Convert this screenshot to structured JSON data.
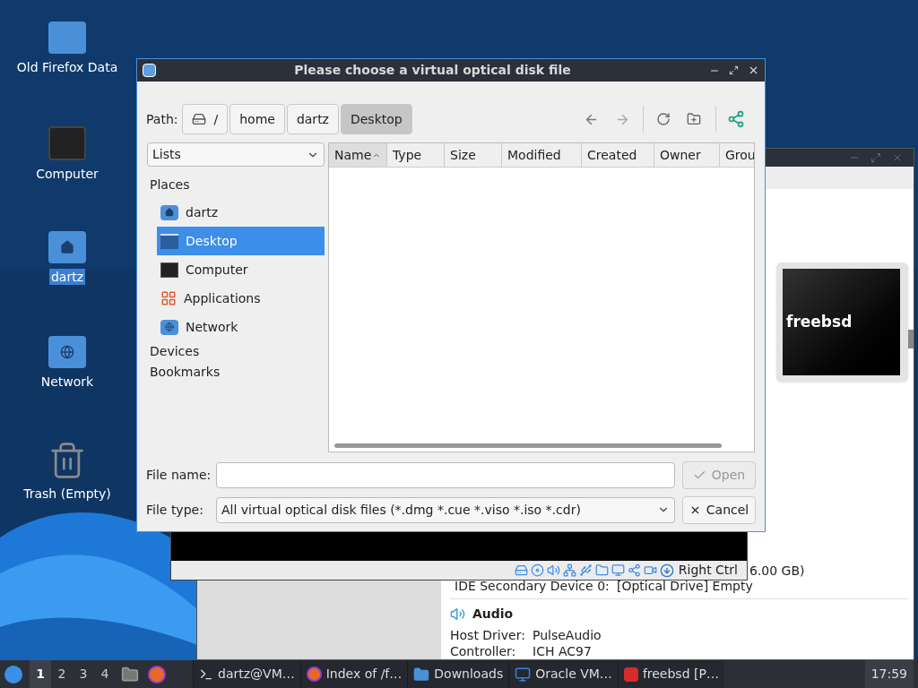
{
  "desktop_icons": [
    {
      "label": "Old Firefox Data",
      "kind": "folder",
      "selected": false
    },
    {
      "label": "Computer",
      "kind": "computer",
      "selected": false
    },
    {
      "label": "dartz",
      "kind": "home",
      "selected": true
    },
    {
      "label": "Network",
      "kind": "network",
      "selected": false
    },
    {
      "label": "Trash (Empty)",
      "kind": "trash",
      "selected": false
    }
  ],
  "manager_window": {
    "preview_title": "freebsd",
    "storage_fragment": "6.00 GB)",
    "storage_rows": [
      {
        "label": "IDE Secondary Device 0:",
        "value": "[Optical Drive] Empty"
      }
    ],
    "audio": {
      "title": "Audio",
      "rows": [
        {
          "label": "Host Driver:",
          "value": "PulseAudio"
        },
        {
          "label": "Controller:",
          "value": "ICH AC97"
        }
      ]
    }
  },
  "vm_window": {
    "host_key": "Right Ctrl"
  },
  "dialog": {
    "title": "Please choose a virtual optical disk file",
    "path_label": "Path:",
    "crumbs": [
      {
        "label": "/",
        "kind": "root",
        "selected": false
      },
      {
        "label": "home",
        "kind": "dir",
        "selected": false
      },
      {
        "label": "dartz",
        "kind": "dir",
        "selected": false
      },
      {
        "label": "Desktop",
        "kind": "dir",
        "selected": true
      }
    ],
    "view_select": "Lists",
    "places_heading": "Places",
    "places": [
      {
        "label": "dartz",
        "kind": "home",
        "selected": false
      },
      {
        "label": "Desktop",
        "kind": "desktop",
        "selected": true
      },
      {
        "label": "Computer",
        "kind": "computer",
        "selected": false
      },
      {
        "label": "Applications",
        "kind": "apps",
        "selected": false
      },
      {
        "label": "Network",
        "kind": "network",
        "selected": false
      }
    ],
    "sections": [
      "Devices",
      "Bookmarks"
    ],
    "columns": [
      {
        "label": "Name",
        "sorted": true
      },
      {
        "label": "Type",
        "sorted": false
      },
      {
        "label": "Size",
        "sorted": false
      },
      {
        "label": "Modified",
        "sorted": false
      },
      {
        "label": "Created",
        "sorted": false
      },
      {
        "label": "Owner",
        "sorted": false
      },
      {
        "label": "Grou",
        "sorted": false
      }
    ],
    "file_name_label": "File name:",
    "file_type_label": "File type:",
    "file_type": "All virtual optical disk files (*.dmg *.cue *.viso *.iso *.cdr)",
    "open_button": {
      "label": "Open",
      "disabled": true
    },
    "cancel_button": "Cancel"
  },
  "taskbar": {
    "workspaces": [
      {
        "label": "1",
        "selected": true
      },
      {
        "label": "2",
        "selected": false
      },
      {
        "label": "3",
        "selected": false
      },
      {
        "label": "4",
        "selected": false
      }
    ],
    "tasks": [
      {
        "label": "dartz@VM…",
        "kind": "terminal"
      },
      {
        "label": "Index of /f…",
        "kind": "browser"
      },
      {
        "label": "Downloads",
        "kind": "folder"
      },
      {
        "label": "Oracle VM…",
        "kind": "virtualbox"
      },
      {
        "label": "freebsd [P…",
        "kind": "vm"
      }
    ],
    "clock": "17:59"
  }
}
